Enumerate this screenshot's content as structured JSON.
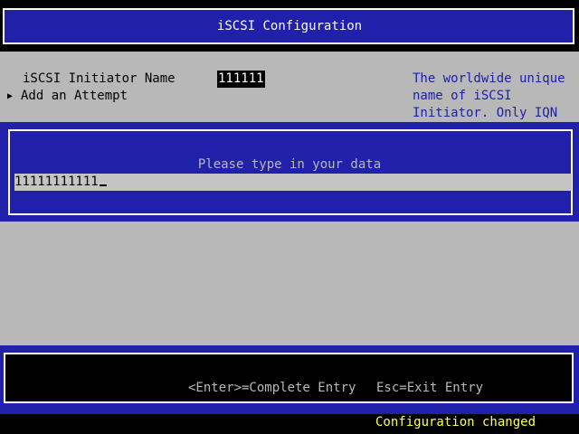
{
  "header": {
    "title": "iSCSI Configuration"
  },
  "form": {
    "initiator_label": "iSCSI Initiator Name",
    "initiator_value": "111111",
    "add_attempt_label": "Add an Attempt",
    "add_attempt_arrow": "▶"
  },
  "help": {
    "lines": [
      "The worldwide unique",
      "name of iSCSI",
      "Initiator. Only IQN"
    ]
  },
  "popup": {
    "prompt": "Please type in your data",
    "input_value": "11111111111"
  },
  "footer": {
    "enter_hint": "<Enter>=Complete Entry",
    "esc_hint": "Esc=Exit Entry"
  },
  "status": {
    "message": "Configuration changed"
  },
  "colors": {
    "panel_blue": "#2020aa",
    "main_grey": "#b8b8b8",
    "status_yellow": "#ffff55",
    "help_blue": "#1e1ea8"
  }
}
